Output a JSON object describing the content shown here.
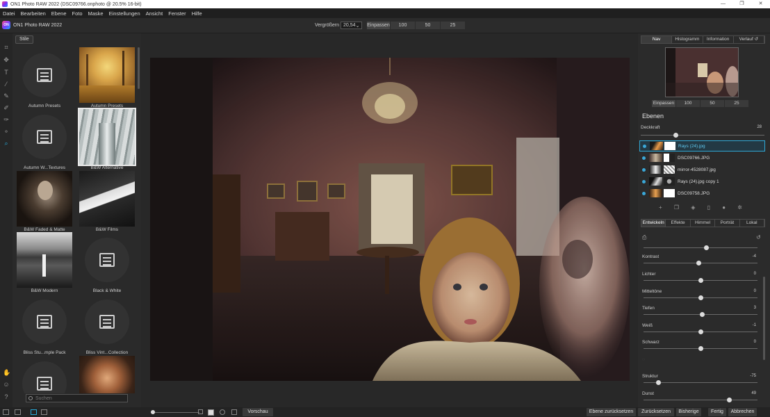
{
  "window": {
    "title": "ON1 Photo RAW 2022 (DSC09766.onphoto @ 20.5% 16-bit)",
    "controls": [
      "—",
      "❐",
      "✕"
    ]
  },
  "menu": [
    "Datei",
    "Bearbeiten",
    "Ebene",
    "Foto",
    "Maske",
    "Einstellungen",
    "Ansicht",
    "Fenster",
    "Hilfe"
  ],
  "brand": {
    "logo": "ON",
    "name": "ON1 Photo RAW 2022"
  },
  "zoom": {
    "label": "Vergrößern",
    "value": "20,54",
    "arrow": "⌄",
    "buttons": [
      "Einpassen",
      "100",
      "50",
      "25"
    ]
  },
  "tools": [
    "crop-icon",
    "move-icon",
    "text-icon",
    "brush-icon",
    "mask-brush-icon",
    "gradient-icon",
    "refine-icon",
    "retouch-icon",
    "perfect-eraser-icon"
  ],
  "styles": {
    "tab": "Stile",
    "presets": [
      {
        "label": "Autumn Presets",
        "kind": "icon"
      },
      {
        "label": "Autumn Presets",
        "kind": "photo"
      },
      {
        "label": "Autumn W...Textures",
        "kind": "icon"
      },
      {
        "label": "B&W Alternative",
        "kind": "photo"
      },
      {
        "label": "B&W Faded & Matte",
        "kind": "photo"
      },
      {
        "label": "B&W Films",
        "kind": "photo"
      },
      {
        "label": "B&W Modern",
        "kind": "photo"
      },
      {
        "label": "Black & White",
        "kind": "icon"
      },
      {
        "label": "Bliss Stu...mple Pack",
        "kind": "icon"
      },
      {
        "label": "Bliss Vint...Collection",
        "kind": "icon"
      },
      {
        "label": "",
        "kind": "icon"
      },
      {
        "label": "",
        "kind": "photo"
      }
    ],
    "search_placeholder": "Suchen"
  },
  "right": {
    "nav_tabs": [
      "Nav",
      "Histogramm",
      "Information",
      "Verlauf"
    ],
    "fit_buttons": [
      "Einpassen",
      "100",
      "50",
      "25"
    ],
    "layers_title": "Ebenen",
    "opacity_label": "Deckkraft",
    "opacity_value": "28",
    "opacity_fraction": 0.28,
    "layers": [
      {
        "name": "Rays (24).jpg",
        "selected": true
      },
      {
        "name": "DSC09766.JPG",
        "selected": false
      },
      {
        "name": "mirror-4528087.jpg",
        "selected": false
      },
      {
        "name": "Rays (24).jpg copy 1",
        "selected": false
      },
      {
        "name": "DSC09758.JPG",
        "selected": false
      }
    ],
    "layer_tool_icons": [
      "add-layer-icon",
      "duplicate-layer-icon",
      "fill-icon",
      "delete-layer-icon",
      "merge-icon",
      "settings-icon"
    ],
    "dev_tabs": [
      "Entwickeln",
      "Effekte",
      "Himmel",
      "Porträt",
      "Lokal"
    ],
    "adjustments": [
      {
        "label": "Kontrast",
        "value": "-4",
        "pos": 0.48
      },
      {
        "label": "Lichter",
        "value": "0",
        "pos": 0.5
      },
      {
        "label": "Mitteltöne",
        "value": "0",
        "pos": 0.5
      },
      {
        "label": "Tiefen",
        "value": "3",
        "pos": 0.51
      },
      {
        "label": "Weiß",
        "value": "-1",
        "pos": 0.5
      },
      {
        "label": "Schwarz",
        "value": "0",
        "pos": 0.5
      },
      {
        "label": "Struktur",
        "value": "-75",
        "pos": 0.13
      },
      {
        "label": "Dunst",
        "value": "49",
        "pos": 0.75
      }
    ]
  },
  "bottom": {
    "preview_label": "Vorschau",
    "buttons": [
      "Ebene zurücksetzen",
      "Zurücksetzen",
      "Bisherige",
      "Fertig",
      "Abbrechen"
    ]
  }
}
